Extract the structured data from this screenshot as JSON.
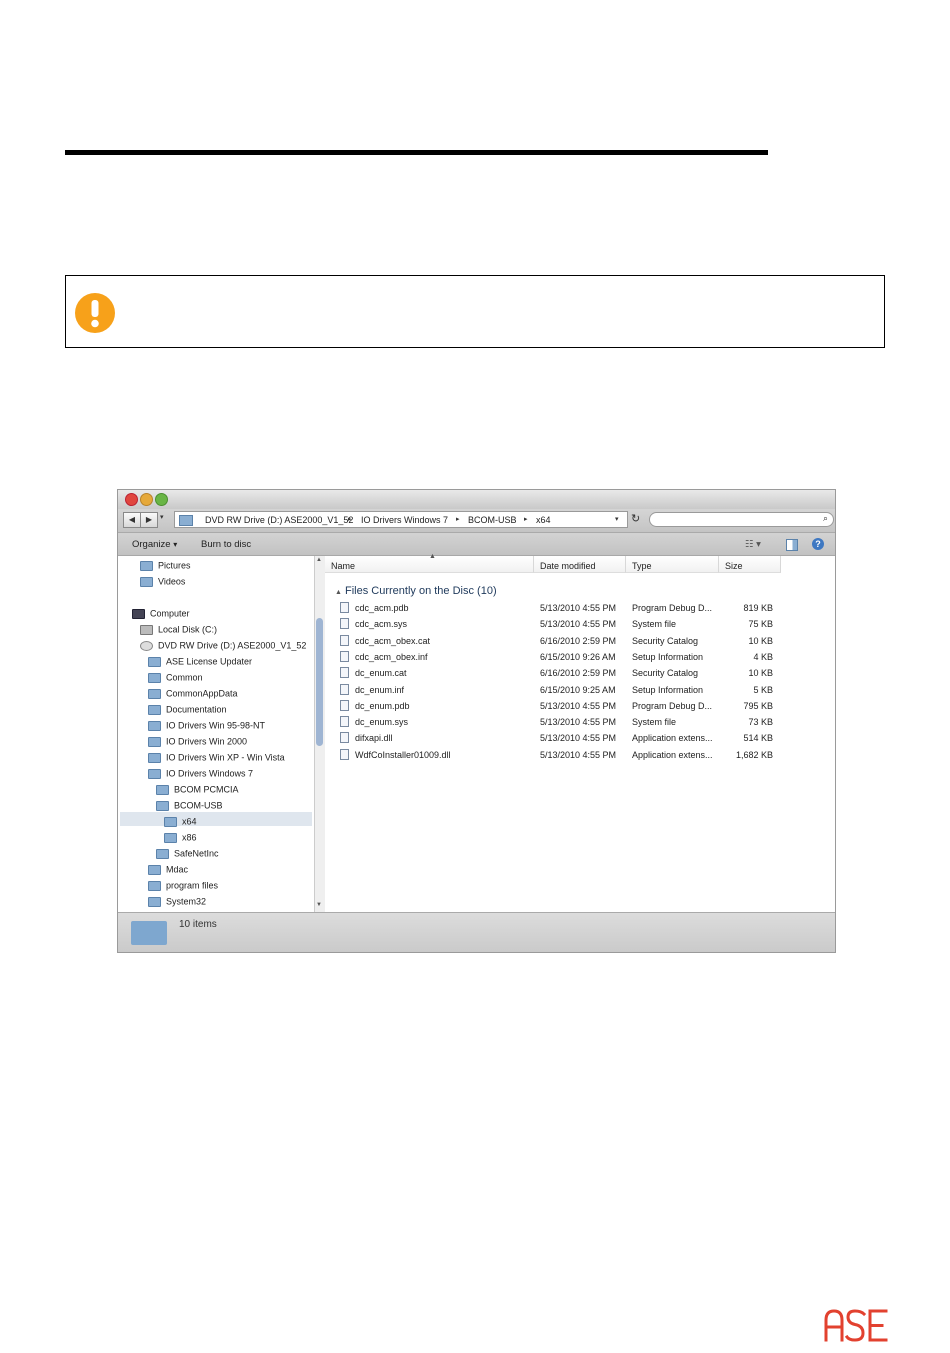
{
  "colors": {
    "warning": "#f7a11a",
    "brand": "#e2412f",
    "accent": "#7ea7cf"
  },
  "page": {
    "warning_icon": "exclamation-circle-icon",
    "brand_logo": "ASE"
  },
  "window": {
    "breadcrumbs": [
      "DVD RW Drive (D:) ASE2000_V1_52",
      "IO Drivers Windows 7",
      "BCOM-USB",
      "x64"
    ],
    "toolbar": {
      "organize_label": "Organize",
      "burn_label": "Burn to disc"
    },
    "nav_items": [
      "Pictures",
      "Videos",
      "Computer",
      "Local Disk (C:)",
      "DVD RW Drive (D:) ASE2000_V1_52",
      "ASE License Updater",
      "Common",
      "CommonAppData",
      "Documentation",
      "IO Drivers Win 95-98-NT",
      "IO Drivers Win 2000",
      "IO Drivers Win XP - Win Vista",
      "IO Drivers Windows 7",
      "BCOM PCMCIA",
      "BCOM-USB",
      "x64",
      "x86",
      "SafeNetInc",
      "Mdac",
      "program files",
      "System32"
    ],
    "columns": [
      "Name",
      "Date modified",
      "Type",
      "Size"
    ],
    "group_label": "Files Currently on the Disc (10)",
    "files": [
      [
        "cdc_acm.pdb",
        "5/13/2010 4:55 PM",
        "Program Debug D...",
        "819 KB"
      ],
      [
        "cdc_acm.sys",
        "5/13/2010 4:55 PM",
        "System file",
        "75 KB"
      ],
      [
        "cdc_acm_obex.cat",
        "6/16/2010 2:59 PM",
        "Security Catalog",
        "10 KB"
      ],
      [
        "cdc_acm_obex.inf",
        "6/15/2010 9:26 AM",
        "Setup Information",
        "4 KB"
      ],
      [
        "dc_enum.cat",
        "6/16/2010 2:59 PM",
        "Security Catalog",
        "10 KB"
      ],
      [
        "dc_enum.inf",
        "6/15/2010 9:25 AM",
        "Setup Information",
        "5 KB"
      ],
      [
        "dc_enum.pdb",
        "5/13/2010 4:55 PM",
        "Program Debug D...",
        "795 KB"
      ],
      [
        "dc_enum.sys",
        "5/13/2010 4:55 PM",
        "System file",
        "73 KB"
      ],
      [
        "difxapi.dll",
        "5/13/2010 4:55 PM",
        "Application extens...",
        "514 KB"
      ],
      [
        "WdfCoInstaller01009.dll",
        "5/13/2010 4:55 PM",
        "Application extens...",
        "1,682 KB"
      ]
    ],
    "status": "10 items"
  }
}
